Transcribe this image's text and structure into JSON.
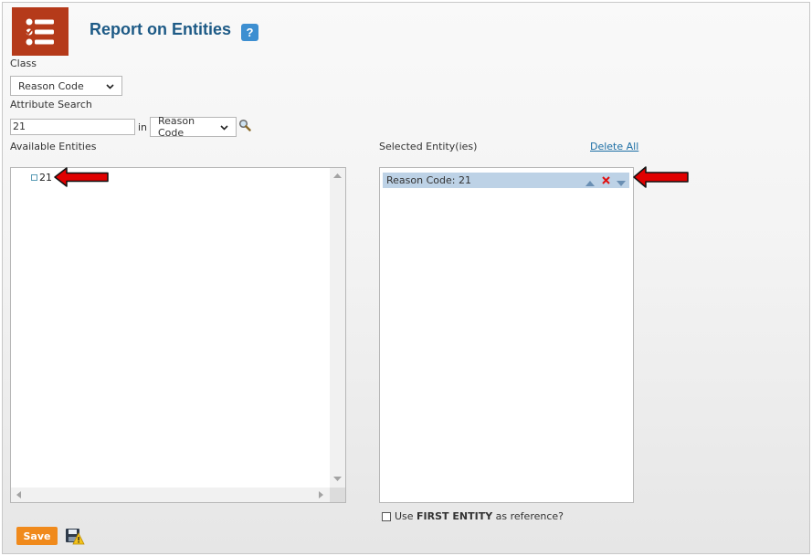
{
  "header": {
    "title": "Report on Entities",
    "help_glyph": "?"
  },
  "class_field": {
    "label": "Class",
    "value": "Reason Code"
  },
  "attribute_search": {
    "label": "Attribute Search",
    "input_value": "21",
    "in_label": "in",
    "attribute_value": "Reason Code"
  },
  "available": {
    "label": "Available Entities",
    "items": [
      {
        "label": "21"
      }
    ]
  },
  "selected": {
    "label": "Selected Entity(ies)",
    "delete_all": "Delete All",
    "items": [
      {
        "label": "Reason Code: 21"
      }
    ]
  },
  "reference": {
    "prefix": "Use ",
    "bold": "FIRST ENTITY",
    "suffix": " as reference?"
  },
  "footer": {
    "save_label": "Save"
  },
  "colors": {
    "brand": "#b53a1a",
    "title": "#1d5a86",
    "save": "#f08a1c",
    "selected_row": "#bdd2e6",
    "annotation_arrow": "#e00000"
  },
  "icons": {
    "logo": "checklist-icon",
    "help": "help-icon",
    "search": "magnifier-icon",
    "move_up": "move-up-icon",
    "remove": "remove-icon",
    "move_down": "move-down-icon",
    "save_disk": "disk-warning-icon"
  }
}
